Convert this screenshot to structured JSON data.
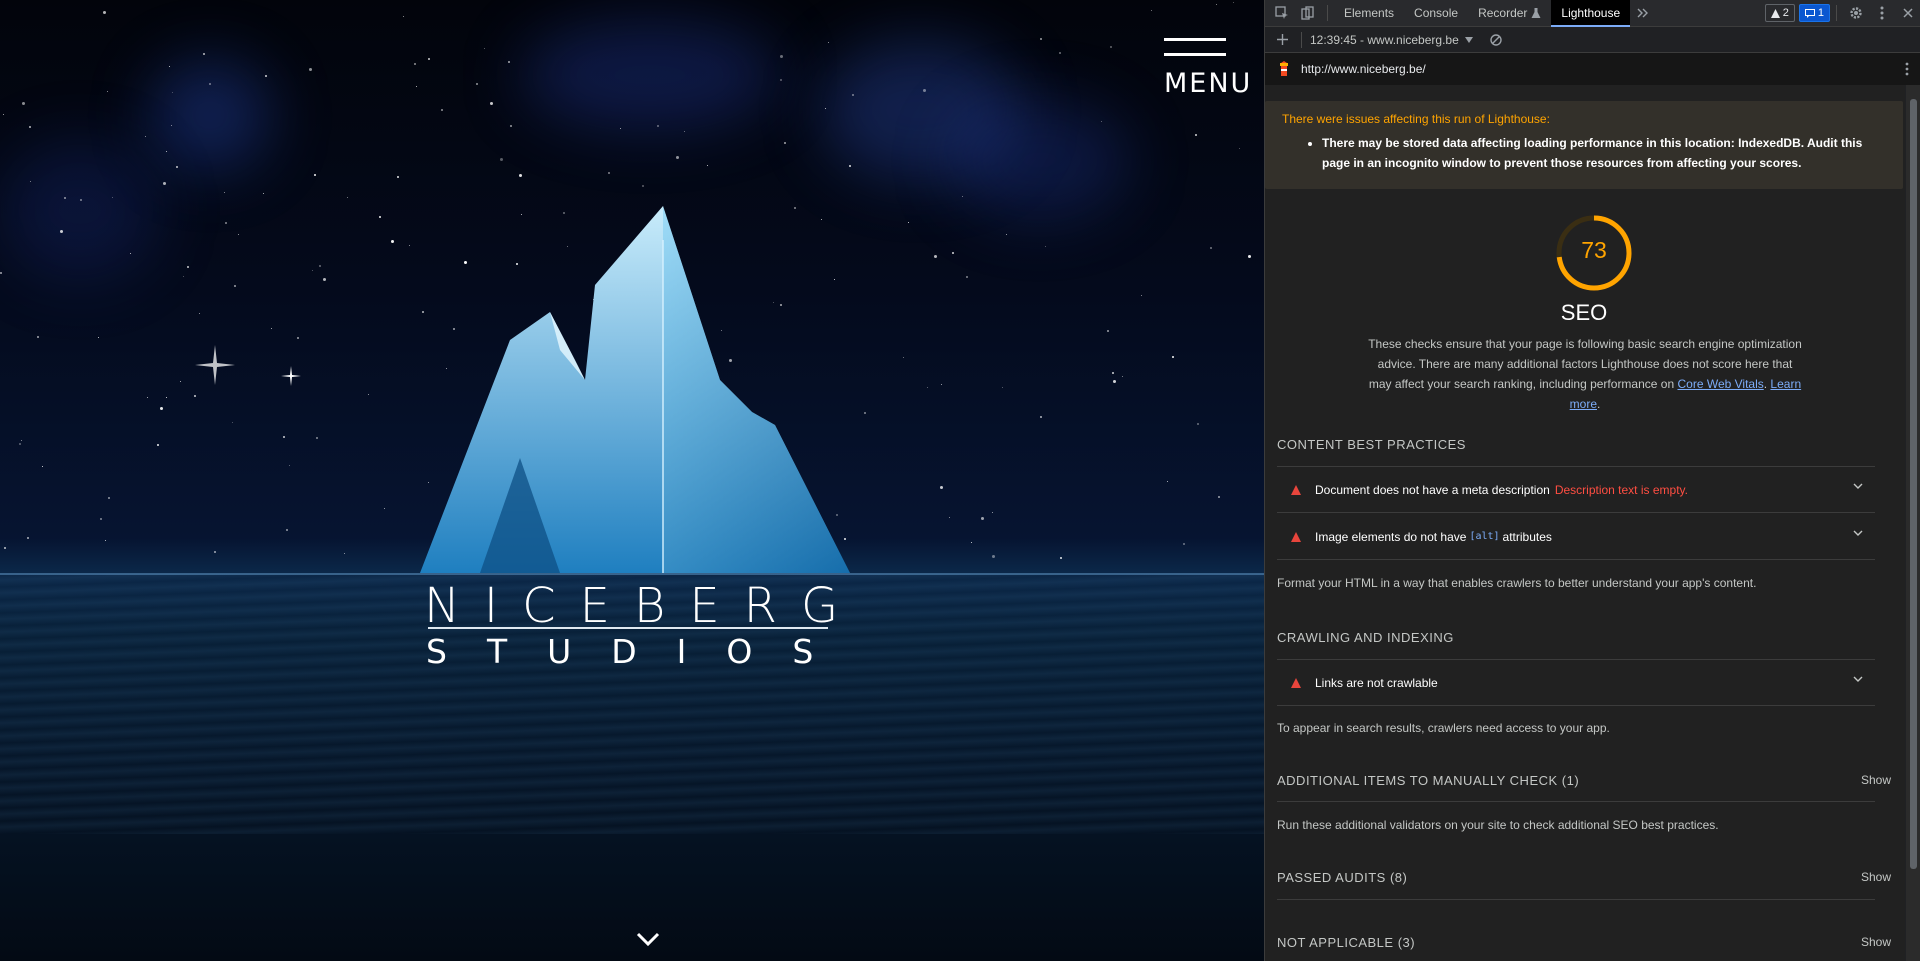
{
  "site": {
    "menu_label": "MENU",
    "logo_line1": "NICEBERG",
    "logo_line2": "STUDIOS"
  },
  "devtools": {
    "tabs": [
      "Elements",
      "Console",
      "Recorder",
      "Lighthouse"
    ],
    "active_tab": "Lighthouse",
    "warnings_count": "2",
    "issues_count": "1",
    "report_selector": "12:39:45 - www.niceberg.be",
    "report_url": "http://www.niceberg.be/",
    "colors": {
      "accent": "#7cacf8",
      "average": "#ffa400",
      "fail": "#e8453c"
    }
  },
  "lighthouse": {
    "warning": {
      "title": "There were issues affecting this run of Lighthouse:",
      "item": "There may be stored data affecting loading performance in this location: IndexedDB. Audit this page in an incognito window to prevent those resources from affecting your scores."
    },
    "score": "73",
    "score_fraction": 0.73,
    "category": "SEO",
    "description": "These checks ensure that your page is following basic search engine optimization advice. There are many additional factors Lighthouse does not score here that may affect your search ranking, including performance on",
    "link_cwv": "Core Web Vitals",
    "link_learn": "Learn more",
    "groups": {
      "content": {
        "title": "CONTENT BEST PRACTICES",
        "audit1": "Document does not have a meta description",
        "audit1_fail": "Description text is empty.",
        "audit2_pre": "Image elements do not have",
        "audit2_code": "[alt]",
        "audit2_post": "attributes",
        "desc": "Format your HTML in a way that enables crawlers to better understand your app's content."
      },
      "crawl": {
        "title": "CRAWLING AND INDEXING",
        "audit1": "Links are not crawlable",
        "desc": "To appear in search results, crawlers need access to your app."
      },
      "manual": {
        "title": "ADDITIONAL ITEMS TO MANUALLY CHECK (1)",
        "show": "Show",
        "desc": "Run these additional validators on your site to check additional SEO best practices."
      },
      "passed": {
        "title": "PASSED AUDITS (8)",
        "show": "Show"
      },
      "na": {
        "title": "NOT APPLICABLE (3)",
        "show": "Show"
      }
    }
  }
}
